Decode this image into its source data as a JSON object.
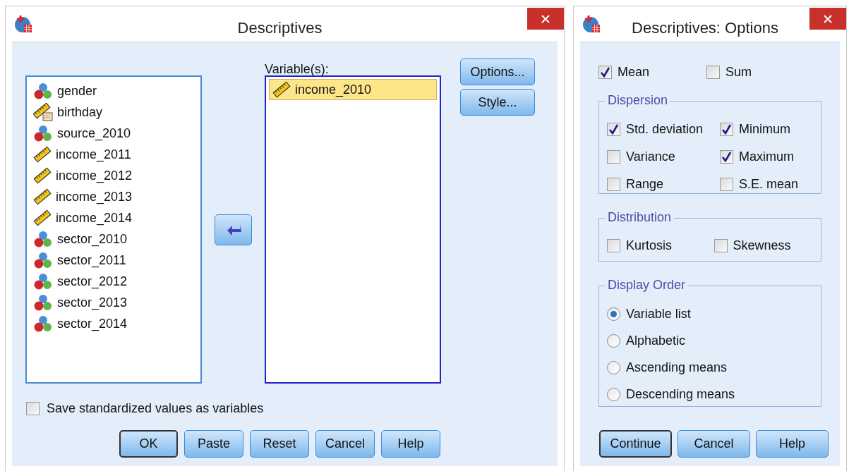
{
  "main_dialog": {
    "title": "Descriptives",
    "source_variables": [
      {
        "name": "gender",
        "kind": "nominal",
        "selected": false
      },
      {
        "name": "birthday",
        "kind": "date",
        "selected": false
      },
      {
        "name": "source_2010",
        "kind": "nominal",
        "selected": false
      },
      {
        "name": "income_2011",
        "kind": "scale",
        "selected": false
      },
      {
        "name": "income_2012",
        "kind": "scale",
        "selected": false
      },
      {
        "name": "income_2013",
        "kind": "scale",
        "selected": false
      },
      {
        "name": "income_2014",
        "kind": "scale",
        "selected": false
      },
      {
        "name": "sector_2010",
        "kind": "nominal",
        "selected": false
      },
      {
        "name": "sector_2011",
        "kind": "nominal",
        "selected": false
      },
      {
        "name": "sector_2012",
        "kind": "nominal",
        "selected": false
      },
      {
        "name": "sector_2013",
        "kind": "nominal",
        "selected": false
      },
      {
        "name": "sector_2014",
        "kind": "nominal",
        "selected": false
      }
    ],
    "target_label": "Variable(s):",
    "target_variables": [
      {
        "name": "income_2010",
        "kind": "scale",
        "selected": true
      }
    ],
    "side_buttons": [
      "Options...",
      "Style..."
    ],
    "save_checkbox": {
      "label": "Save standardized values as variables",
      "checked": false
    },
    "buttons": [
      {
        "label": "OK",
        "default": true
      },
      {
        "label": "Paste",
        "default": false
      },
      {
        "label": "Reset",
        "default": false
      },
      {
        "label": "Cancel",
        "default": false
      },
      {
        "label": "Help",
        "default": false
      }
    ]
  },
  "options_dialog": {
    "title": "Descriptives: Options",
    "top_checks": [
      {
        "label": "Mean",
        "checked": true
      },
      {
        "label": "Sum",
        "checked": false
      }
    ],
    "dispersion": {
      "title": "Dispersion",
      "checks": [
        {
          "label": "Std. deviation",
          "checked": true
        },
        {
          "label": "Minimum",
          "checked": true
        },
        {
          "label": "Variance",
          "checked": false
        },
        {
          "label": "Maximum",
          "checked": true
        },
        {
          "label": "Range",
          "checked": false
        },
        {
          "label": "S.E. mean",
          "checked": false
        }
      ]
    },
    "distribution": {
      "title": "Distribution",
      "checks": [
        {
          "label": "Kurtosis",
          "checked": false
        },
        {
          "label": "Skewness",
          "checked": false
        }
      ]
    },
    "display_order": {
      "title": "Display Order",
      "options": [
        {
          "label": "Variable list",
          "selected": true
        },
        {
          "label": "Alphabetic",
          "selected": false
        },
        {
          "label": "Ascending means",
          "selected": false
        },
        {
          "label": "Descending means",
          "selected": false
        }
      ]
    },
    "buttons": [
      {
        "label": "Continue",
        "default": true
      },
      {
        "label": "Cancel",
        "default": false
      },
      {
        "label": "Help",
        "default": false
      }
    ]
  }
}
